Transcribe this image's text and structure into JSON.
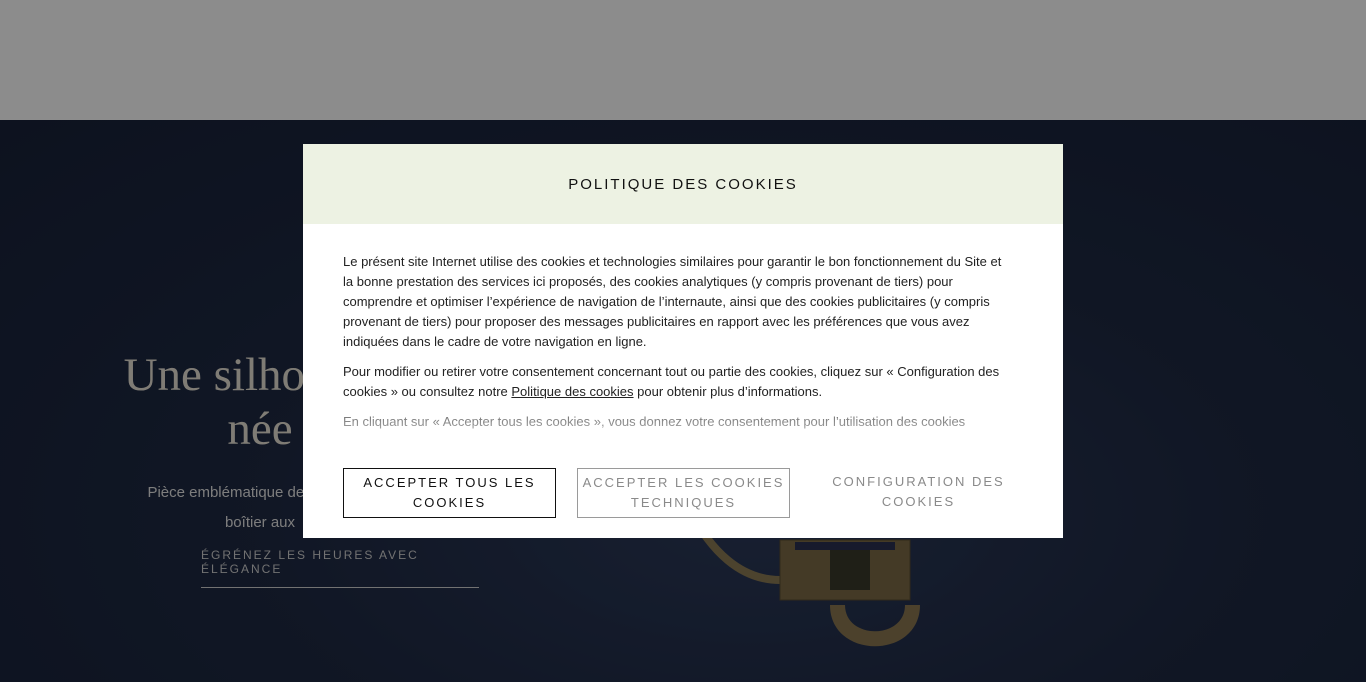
{
  "hero": {
    "title": "Une silhouette\nnée",
    "description": "Pièce emblématique de la Maison\nboîtier aux",
    "link_label": "ÉGRÉNEZ LES HEURES AVEC ÉLÉGANCE"
  },
  "cookie_modal": {
    "title": "POLITIQUE DES COOKIES",
    "paragraph1": "Le présent site Internet utilise des cookies et technologies similaires pour garantir le bon fonctionnement du Site et la bonne prestation des services ici proposés, des cookies analytiques (y compris provenant de tiers) pour comprendre et optimiser l’expérience de navigation de l’internaute, ainsi que des cookies publicitaires (y compris provenant de tiers) pour proposer des messages publicitaires en rapport avec les préférences que vous avez indiquées dans le cadre de votre navigation en ligne.",
    "paragraph2_before": "Pour modifier ou retirer votre consentement concernant tout ou partie des cookies, cliquez sur « Configuration des cookies » ou consultez notre ",
    "paragraph2_link": "Politique des cookies",
    "paragraph2_after": " pour obtenir plus d’informations.",
    "paragraph3": "En cliquant sur « Accepter tous les cookies », vous donnez votre consentement pour l’utilisation des cookies",
    "buttons": {
      "accept_all": "ACCEPTER TOUS LES COOKIES",
      "accept_technical": "ACCEPTER LES COOKIES TECHNIQUES",
      "configure": "CONFIGURATION DES COOKIES"
    }
  },
  "colors": {
    "modal_header_bg": "#edf2e3",
    "hero_bg": "#1f2a44",
    "overlay": "rgba(0,0,0,0.45)"
  }
}
